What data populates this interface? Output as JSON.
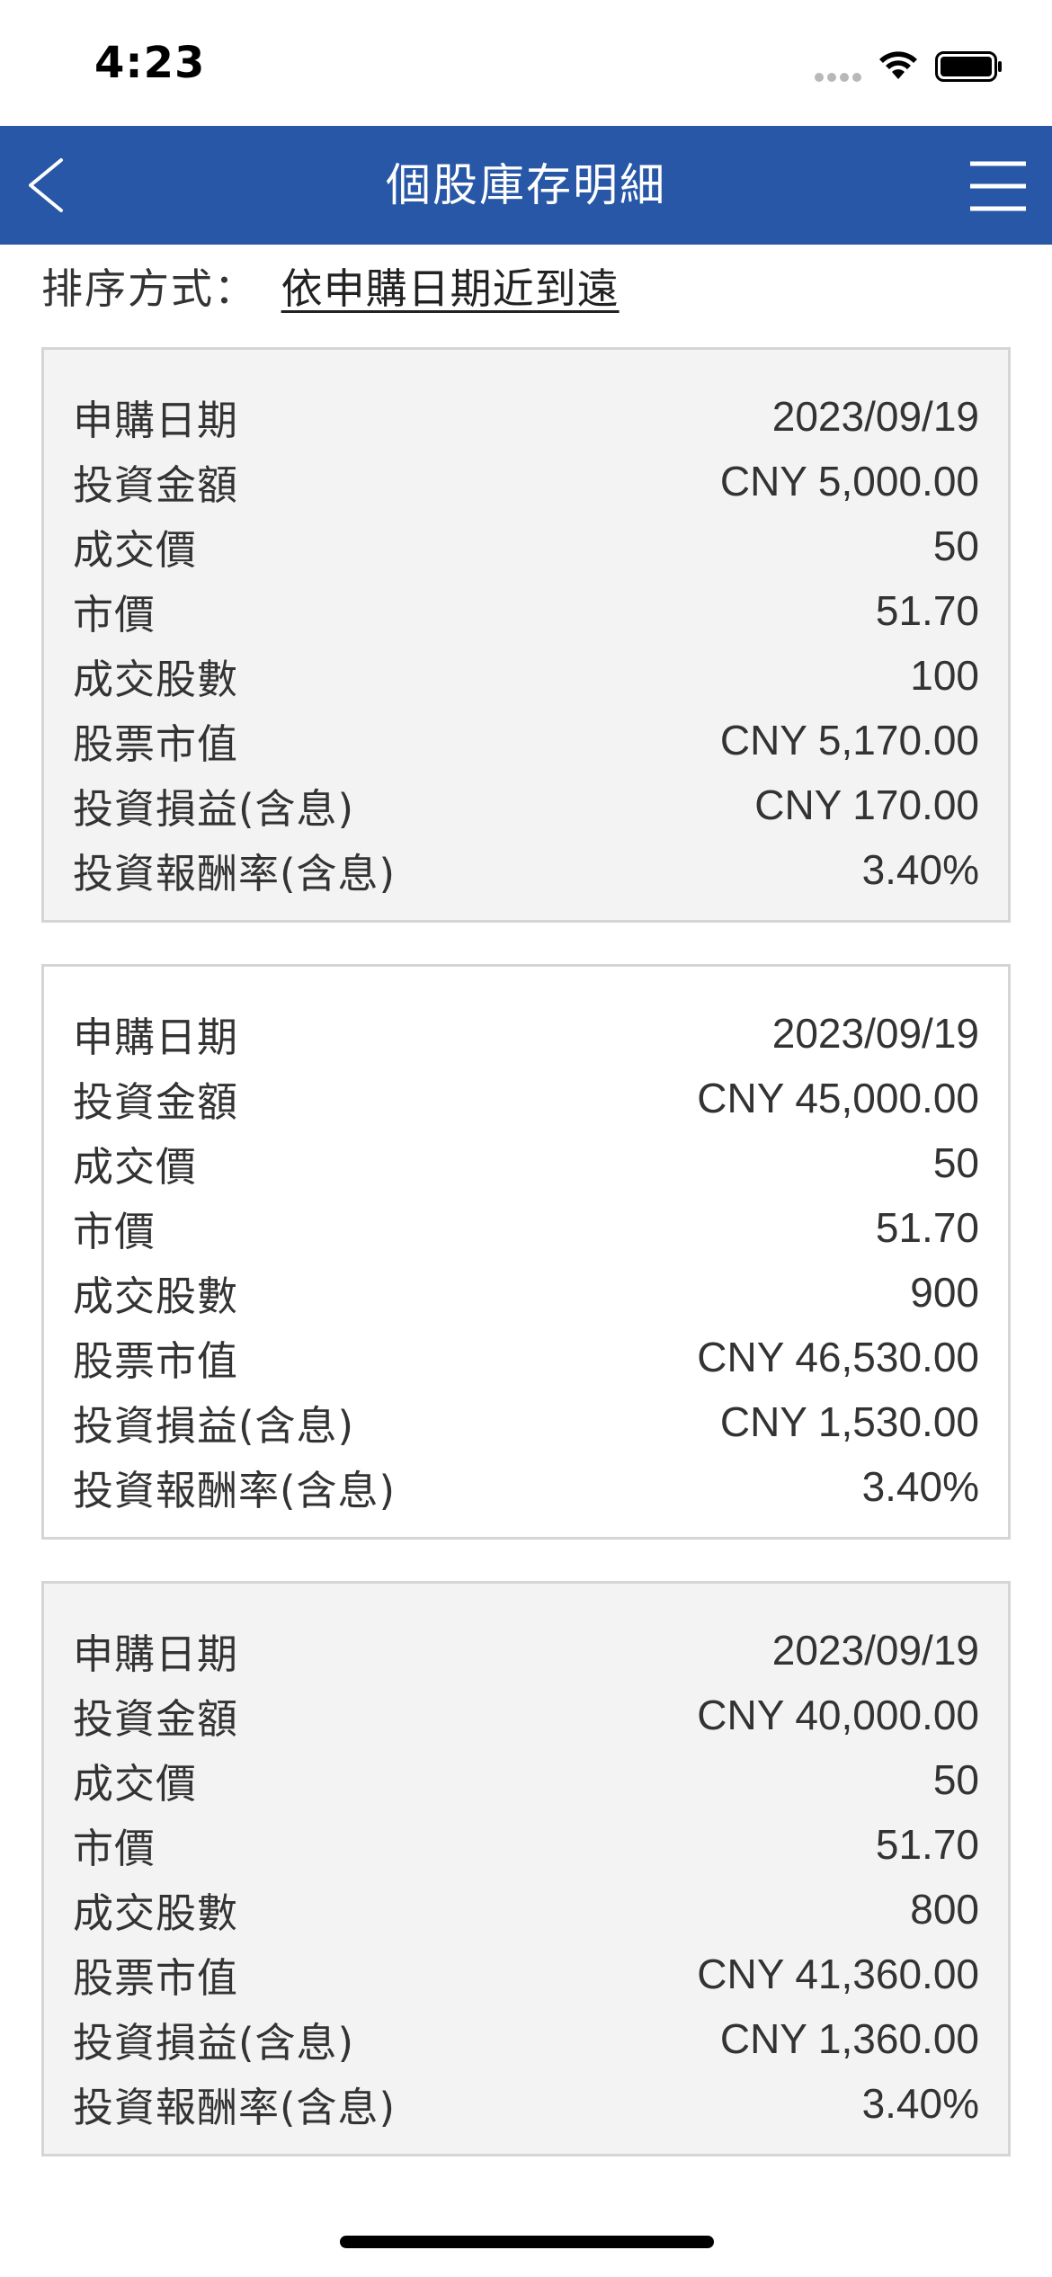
{
  "status_bar": {
    "time": "4:23",
    "icons": [
      "signal-dots-icon",
      "wifi-icon",
      "battery-icon"
    ]
  },
  "nav": {
    "title": "個股庫存明細",
    "back_icon": "chevron-left-icon",
    "menu_icon": "hamburger-menu-icon",
    "background_color": "#2757a6"
  },
  "sort": {
    "label": "排序方式：",
    "value": "依申購日期近到遠"
  },
  "cards": [
    {
      "rows": [
        {
          "label": "申購日期",
          "value": "2023/09/19"
        },
        {
          "label": "投資金額",
          "value": "CNY 5,000.00"
        },
        {
          "label": "成交價",
          "value": "50"
        },
        {
          "label": "市價",
          "value": "51.70"
        },
        {
          "label": "成交股數",
          "value": "100"
        },
        {
          "label": "股票市值",
          "value": "CNY 5,170.00"
        },
        {
          "label": "投資損益(含息)",
          "value": "CNY 170.00"
        },
        {
          "label": "投資報酬率(含息)",
          "value": "3.40%"
        }
      ]
    },
    {
      "rows": [
        {
          "label": "申購日期",
          "value": "2023/09/19"
        },
        {
          "label": "投資金額",
          "value": "CNY 45,000.00"
        },
        {
          "label": "成交價",
          "value": "50"
        },
        {
          "label": "市價",
          "value": "51.70"
        },
        {
          "label": "成交股數",
          "value": "900"
        },
        {
          "label": "股票市值",
          "value": "CNY 46,530.00"
        },
        {
          "label": "投資損益(含息)",
          "value": "CNY 1,530.00"
        },
        {
          "label": "投資報酬率(含息)",
          "value": "3.40%"
        }
      ]
    },
    {
      "rows": [
        {
          "label": "申購日期",
          "value": "2023/09/19"
        },
        {
          "label": "投資金額",
          "value": "CNY 40,000.00"
        },
        {
          "label": "成交價",
          "value": "50"
        },
        {
          "label": "市價",
          "value": "51.70"
        },
        {
          "label": "成交股數",
          "value": "800"
        },
        {
          "label": "股票市值",
          "value": "CNY 41,360.00"
        },
        {
          "label": "投資損益(含息)",
          "value": "CNY 1,360.00"
        },
        {
          "label": "投資報酬率(含息)",
          "value": "3.40%"
        }
      ]
    }
  ]
}
